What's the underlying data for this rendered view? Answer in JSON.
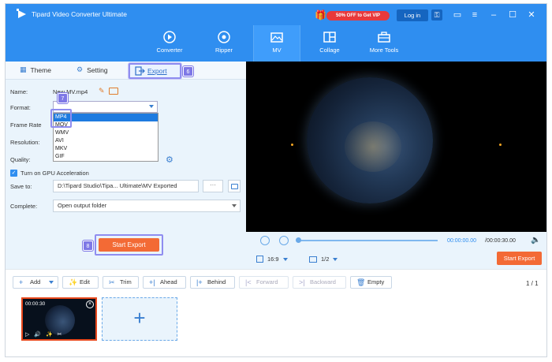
{
  "app": {
    "title": "Tipard Video Converter Ultimate",
    "promo": "50% OFF to Get VIP",
    "login": "Log in"
  },
  "nav": [
    {
      "label": "Converter",
      "icon": "converter-icon"
    },
    {
      "label": "Ripper",
      "icon": "ripper-icon"
    },
    {
      "label": "MV",
      "icon": "mv-icon",
      "active": true
    },
    {
      "label": "Collage",
      "icon": "collage-icon"
    },
    {
      "label": "More Tools",
      "icon": "toolbox-icon"
    }
  ],
  "tabs": {
    "theme": "Theme",
    "setting": "Setting",
    "export": "Export"
  },
  "callouts": {
    "export": "6",
    "format": "7",
    "start": "8"
  },
  "settings": {
    "name_label": "Name:",
    "name_value": "New MV.mp4",
    "format_label": "Format:",
    "frame_rate_label": "Frame Rate",
    "resolution_label": "Resolution:",
    "quality_label": "Quality:",
    "gpu_label": "Turn on GPU Acceleration",
    "save_label": "Save to:",
    "save_value": "D:\\Tipard Studio\\Tipa... Ultimate\\MV Exported",
    "save_more": "···",
    "complete_label": "Complete:",
    "complete_value": "Open output folder",
    "format_options": [
      "MP4",
      "MOV",
      "WMV",
      "AVI",
      "MKV",
      "GIF"
    ]
  },
  "start_export": "Start Export",
  "player": {
    "current": "00:00:00.00",
    "total": "/00:00:30.00",
    "ratio": "16:9",
    "page": "1/2",
    "export": "Start Export"
  },
  "toolbar": {
    "add": "Add",
    "edit": "Edit",
    "trim": "Trim",
    "ahead": "Ahead",
    "behind": "Behind",
    "forward": "Forward",
    "backward": "Backward",
    "empty": "Empty",
    "page_count": "1 / 1"
  },
  "clip": {
    "duration": "00:00:30"
  },
  "colors": {
    "brand_blue": "#2f8ef0",
    "accent_orange": "#f36a35",
    "callout": "#7e78e6"
  }
}
